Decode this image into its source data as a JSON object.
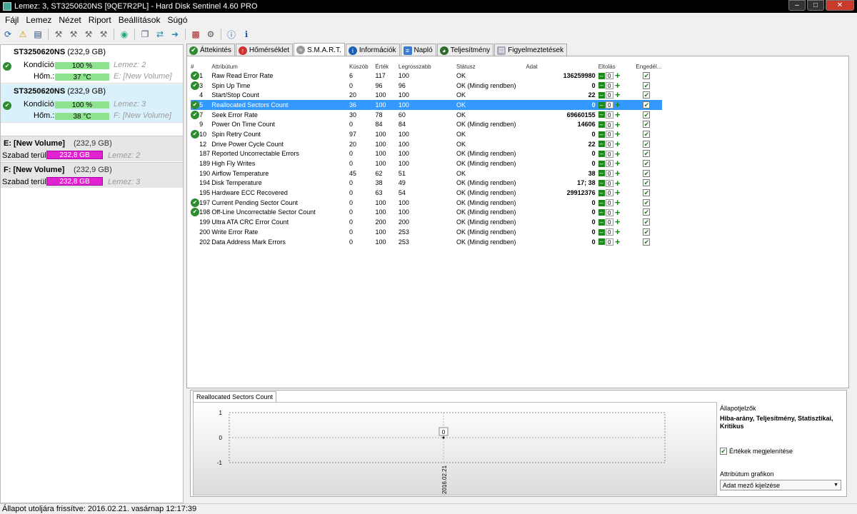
{
  "window": {
    "title": "Lemez: 3, ST3250620NS [9QE7R2PL]  -  Hard Disk Sentinel 4.60 PRO"
  },
  "menu": [
    "Fájl",
    "Lemez",
    "Nézet",
    "Riport",
    "Beállítások",
    "Súgó"
  ],
  "disks": [
    {
      "name": "ST3250620NS",
      "size": "(232,9 GB)",
      "kondicio_label": "Kondíció:",
      "kondicio": "100 %",
      "kondicio_pct": 100,
      "disk_ref": "Lemez: 2",
      "hom_label": "Hőm.:",
      "hom": "37 °C",
      "volume": "E: [New Volume]"
    },
    {
      "name": "ST3250620NS",
      "size": "(232,9 GB)",
      "kondicio_label": "Kondíció:",
      "kondicio": "100 %",
      "kondicio_pct": 100,
      "disk_ref": "Lemez: 3",
      "hom_label": "Hőm.:",
      "hom": "38 °C",
      "volume": "F: [New Volume]"
    }
  ],
  "volumes": [
    {
      "name": "E: [New Volume]",
      "size": "(232,9 GB)",
      "free_label": "Szabad terület",
      "free": "232,8 GB",
      "disk_ref": "Lemez: 2"
    },
    {
      "name": "F: [New Volume]",
      "size": "(232,9 GB)",
      "free_label": "Szabad terület",
      "free": "232,8 GB",
      "disk_ref": "Lemez: 3"
    }
  ],
  "tabs": [
    "Áttekintés",
    "Hőmérséklet",
    "S.M.A.R.T.",
    "Információk",
    "Napló",
    "Teljesítmény",
    "Figyelmeztetések"
  ],
  "active_tab": "S.M.A.R.T.",
  "smart": {
    "columns": [
      "#",
      "Attribútum",
      "Küszöb",
      "Érték",
      "Legrosszabb",
      "Státusz",
      "Adat",
      "Eltolás",
      "Engedél..."
    ],
    "rows": [
      {
        "ok": true,
        "id": "1",
        "attr": "Raw Read Error Rate",
        "thr": "6",
        "val": "117",
        "worst": "100",
        "status": "OK",
        "data": "136259980",
        "offset": "0"
      },
      {
        "ok": true,
        "id": "3",
        "attr": "Spin Up Time",
        "thr": "0",
        "val": "96",
        "worst": "96",
        "status": "OK (Mindig rendben)",
        "data": "0",
        "offset": "0"
      },
      {
        "ok": false,
        "id": "4",
        "attr": "Start/Stop Count",
        "thr": "20",
        "val": "100",
        "worst": "100",
        "status": "OK",
        "data": "22",
        "offset": "0"
      },
      {
        "ok": true,
        "id": "5",
        "attr": "Reallocated Sectors Count",
        "thr": "36",
        "val": "100",
        "worst": "100",
        "status": "OK",
        "data": "0",
        "offset": "0",
        "selected": true
      },
      {
        "ok": true,
        "id": "7",
        "attr": "Seek Error Rate",
        "thr": "30",
        "val": "78",
        "worst": "60",
        "status": "OK",
        "data": "69660155",
        "offset": "0"
      },
      {
        "ok": false,
        "id": "9",
        "attr": "Power On Time Count",
        "thr": "0",
        "val": "84",
        "worst": "84",
        "status": "OK (Mindig rendben)",
        "data": "14606",
        "offset": "0"
      },
      {
        "ok": true,
        "id": "10",
        "attr": "Spin Retry Count",
        "thr": "97",
        "val": "100",
        "worst": "100",
        "status": "OK",
        "data": "0",
        "offset": "0"
      },
      {
        "ok": false,
        "id": "12",
        "attr": "Drive Power Cycle Count",
        "thr": "20",
        "val": "100",
        "worst": "100",
        "status": "OK",
        "data": "22",
        "offset": "0"
      },
      {
        "ok": false,
        "id": "187",
        "attr": "Reported Uncorrectable Errors",
        "thr": "0",
        "val": "100",
        "worst": "100",
        "status": "OK (Mindig rendben)",
        "data": "0",
        "offset": "0"
      },
      {
        "ok": false,
        "id": "189",
        "attr": "High Fly Writes",
        "thr": "0",
        "val": "100",
        "worst": "100",
        "status": "OK (Mindig rendben)",
        "data": "0",
        "offset": "0"
      },
      {
        "ok": false,
        "id": "190",
        "attr": "Airflow Temperature",
        "thr": "45",
        "val": "62",
        "worst": "51",
        "status": "OK",
        "data": "38",
        "offset": "0"
      },
      {
        "ok": false,
        "id": "194",
        "attr": "Disk Temperature",
        "thr": "0",
        "val": "38",
        "worst": "49",
        "status": "OK (Mindig rendben)",
        "data": "17; 38",
        "offset": "0"
      },
      {
        "ok": false,
        "id": "195",
        "attr": "Hardware ECC Recovered",
        "thr": "0",
        "val": "63",
        "worst": "54",
        "status": "OK (Mindig rendben)",
        "data": "29912376",
        "offset": "0"
      },
      {
        "ok": true,
        "id": "197",
        "attr": "Current Pending Sector Count",
        "thr": "0",
        "val": "100",
        "worst": "100",
        "status": "OK (Mindig rendben)",
        "data": "0",
        "offset": "0"
      },
      {
        "ok": true,
        "id": "198",
        "attr": "Off-Line Uncorrectable Sector Count",
        "thr": "0",
        "val": "100",
        "worst": "100",
        "status": "OK (Mindig rendben)",
        "data": "0",
        "offset": "0"
      },
      {
        "ok": false,
        "id": "199",
        "attr": "Ultra ATA CRC Error Count",
        "thr": "0",
        "val": "200",
        "worst": "200",
        "status": "OK (Mindig rendben)",
        "data": "0",
        "offset": "0"
      },
      {
        "ok": false,
        "id": "200",
        "attr": "Write Error Rate",
        "thr": "0",
        "val": "100",
        "worst": "253",
        "status": "OK (Mindig rendben)",
        "data": "0",
        "offset": "0"
      },
      {
        "ok": false,
        "id": "202",
        "attr": "Data Address Mark Errors",
        "thr": "0",
        "val": "100",
        "worst": "253",
        "status": "OK (Mindig rendben)",
        "data": "0",
        "offset": "0"
      }
    ]
  },
  "graph": {
    "tab": "Reallocated Sectors Count",
    "y_ticks": [
      "1",
      "0",
      "-1"
    ],
    "point_label": "0",
    "date": "2016.02.21",
    "right_title": "Állapotjelzők",
    "right_text": "Hiba-arány, Teljesítmény, Statisztikai, Kritikus",
    "checkbox_label": "Értékek megjelenítése",
    "combo_label": "Attribútum grafikon",
    "combo_value": "Adat mező kijelzése"
  },
  "status": "Állapot utoljára frissítve: 2016.02.21. vasárnap 12:17:39",
  "colors": {
    "selection": "#3399ff",
    "health_bar": "#8ee48e",
    "free_bar": "#e022d0",
    "ok_green": "#2e8b2e"
  }
}
